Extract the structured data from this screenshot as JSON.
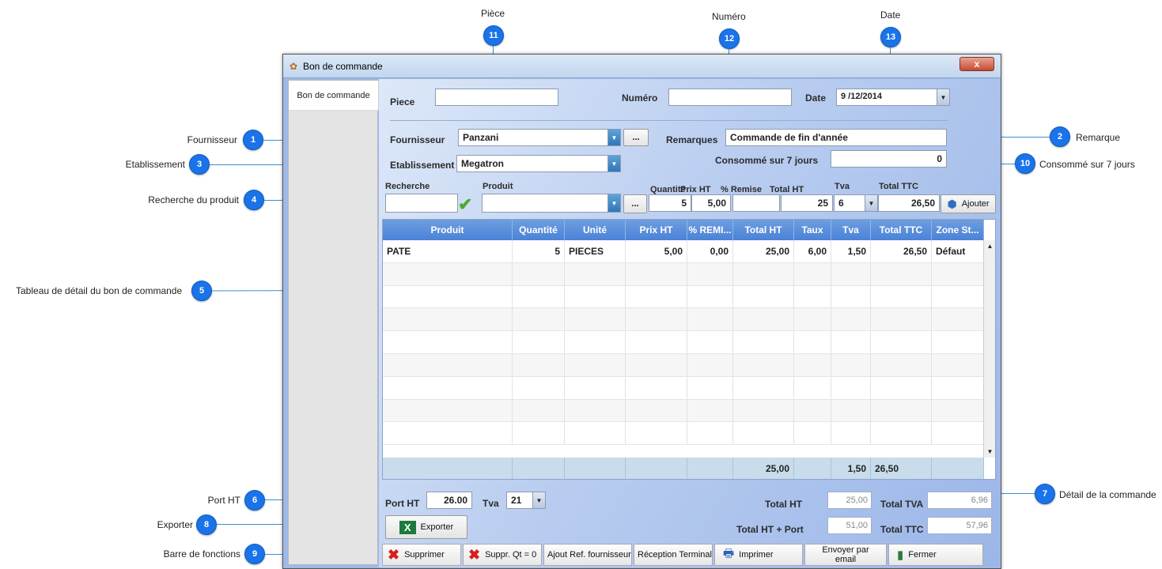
{
  "window": {
    "title": "Bon de commande",
    "close_label": "x",
    "tab_label": "Bon de commande"
  },
  "header": {
    "piece_label": "Piece",
    "piece_value": "",
    "numero_label": "Numéro",
    "numero_value": "",
    "date_label": "Date",
    "date_value": "9 /12/2014",
    "fournisseur_label": "Fournisseur",
    "fournisseur_value": "Panzani",
    "ellipsis": "...",
    "remarques_label": "Remarques",
    "remarques_value": "Commande de fin d'année",
    "etablissement_label": "Etablissement",
    "etablissement_value": "Megatron",
    "consomme_label": "Consommé sur 7 jours",
    "consomme_value": "0"
  },
  "entry": {
    "recherche_label": "Recherche",
    "recherche_value": "",
    "produit_label": "Produit",
    "produit_value": "",
    "ellipsis": "...",
    "quantite_label": "Quantité",
    "quantite_value": "5",
    "prixht_label": "Prix HT",
    "prixht_value": "5,00",
    "remise_label": "% Remise",
    "remise_value": "",
    "totalht_label": "Total HT",
    "totalht_value": "25",
    "tva_label": "Tva",
    "tva_value": "6",
    "totalttc_label": "Total TTC",
    "totalttc_value": "26,50",
    "ajouter_label": "Ajouter"
  },
  "table": {
    "columns": [
      "Produit",
      "Quantité",
      "Unité",
      "Prix HT",
      "% REMI...",
      "Total HT",
      "Taux",
      "Tva",
      "Total TTC",
      "Zone St..."
    ],
    "rows": [
      [
        "PATE",
        "5",
        "PIECES",
        "5,00",
        "0,00",
        "25,00",
        "6,00",
        "1,50",
        "26,50",
        "Défaut"
      ]
    ],
    "footer": [
      "",
      "",
      "",
      "",
      "",
      "25,00",
      "",
      "1,50",
      "26,50",
      ""
    ]
  },
  "bottom": {
    "port_label": "Port HT",
    "port_value": "26.00",
    "tva_label": "Tva",
    "tva_value": "21",
    "total_ht_label": "Total HT",
    "total_ht_value": "25,00",
    "total_tva_label": "Total TVA",
    "total_tva_value": "6,96",
    "total_ht_port_label": "Total HT + Port",
    "total_ht_port_value": "51,00",
    "total_ttc_label": "Total TTC",
    "total_ttc_value": "57,96",
    "exporter_label": "Exporter"
  },
  "toolbar": {
    "supprimer": "Supprimer",
    "suppr_qt0": "Suppr. Qt = 0",
    "ajout_ref": "Ajout Ref. fournisseur",
    "reception": "Réception Terminal",
    "imprimer": "Imprimer",
    "envoyer": "Envoyer par email",
    "fermer": "Fermer"
  },
  "annotations": {
    "a1": {
      "num": "1",
      "label": "Fournisseur"
    },
    "a2": {
      "num": "2",
      "label": "Remarque"
    },
    "a3": {
      "num": "3",
      "label": "Etablissement"
    },
    "a4": {
      "num": "4",
      "label": "Recherche du produit"
    },
    "a5": {
      "num": "5",
      "label": "Tableau de détail du bon de commande"
    },
    "a6": {
      "num": "6",
      "label": "Port HT"
    },
    "a7": {
      "num": "7",
      "label": "Détail de la commande"
    },
    "a8": {
      "num": "8",
      "label": "Exporter"
    },
    "a9": {
      "num": "9",
      "label": "Barre de fonctions"
    },
    "a10": {
      "num": "10",
      "label": "Consommé sur 7 jours"
    },
    "a11": {
      "num": "11",
      "label": "Pièce"
    },
    "a12": {
      "num": "12",
      "label": "Numéro"
    },
    "a13": {
      "num": "13",
      "label": "Date"
    }
  },
  "colors": {
    "badge": "#1a73e8",
    "grid_header": "#4a82d6",
    "window_bg": "#9dbae8"
  }
}
